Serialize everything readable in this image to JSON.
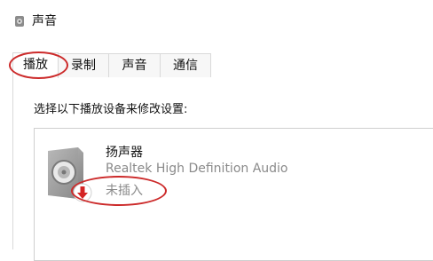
{
  "window": {
    "title": "声音",
    "icon": "speaker-icon"
  },
  "tabs": [
    {
      "label": "播放",
      "active": true
    },
    {
      "label": "录制",
      "active": false
    },
    {
      "label": "声音",
      "active": false
    },
    {
      "label": "通信",
      "active": false
    }
  ],
  "playback": {
    "instruction": "选择以下播放设备来修改设置:",
    "devices": [
      {
        "name": "扬声器",
        "description": "Realtek High Definition Audio",
        "status": "未插入",
        "icon": "speaker-device-icon",
        "status_icon": "red-down-arrow-icon"
      }
    ]
  },
  "colors": {
    "annotation": "#cc2a2a",
    "status_text": "#8a8a8a",
    "border": "#d9d9d9"
  }
}
